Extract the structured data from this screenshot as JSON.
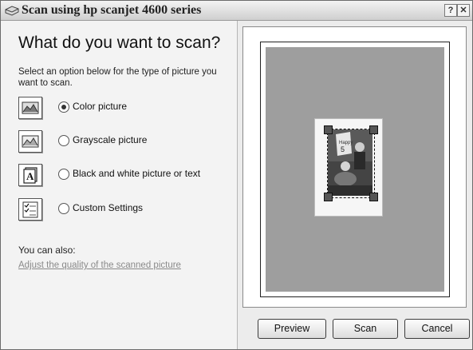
{
  "window": {
    "title": "Scan using hp scanjet 4600 series"
  },
  "titlebar_buttons": {
    "help": "?",
    "close": "✕"
  },
  "main": {
    "heading": "What do you want to scan?",
    "intro": "Select an option below for the type of picture you want to scan.",
    "options": [
      {
        "label": "Color picture",
        "selected": true,
        "icon": "color-picture-icon"
      },
      {
        "label": "Grayscale picture",
        "selected": false,
        "icon": "grayscale-picture-icon"
      },
      {
        "label": "Black and white picture or text",
        "selected": false,
        "icon": "black-white-text-icon"
      },
      {
        "label": "Custom Settings",
        "selected": false,
        "icon": "custom-settings-icon"
      }
    ],
    "also_label": "You can also:",
    "adjust_link": "Adjust the quality of the scanned picture"
  },
  "buttons": {
    "preview": "Preview",
    "scan": "Scan",
    "cancel": "Cancel"
  }
}
